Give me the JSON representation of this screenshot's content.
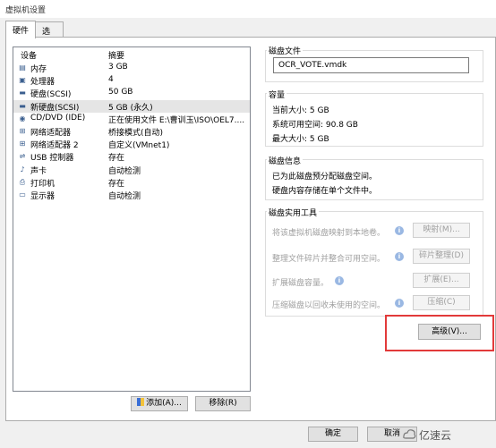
{
  "window": {
    "title": "虚拟机设置"
  },
  "tabs": [
    "硬件",
    "选项"
  ],
  "devices": {
    "col_device": "设备",
    "col_summary": "摘要",
    "rows": [
      {
        "name": "内存",
        "summary": "3 GB",
        "icon": "memory-icon"
      },
      {
        "name": "处理器",
        "summary": "4",
        "icon": "cpu-icon"
      },
      {
        "name": "硬盘(SCSI)",
        "summary": "50 GB",
        "icon": "disk-icon"
      },
      {
        "name": "新硬盘(SCSI)",
        "summary": "5 GB (永久)",
        "icon": "disk-icon",
        "selected": true
      },
      {
        "name": "CD/DVD (IDE)",
        "summary": "正在使用文件 E:\\曹训玉\\ISO\\OEL7....",
        "icon": "cd-icon"
      },
      {
        "name": "网络适配器",
        "summary": "桥接模式(自动)",
        "icon": "network-icon"
      },
      {
        "name": "网络适配器 2",
        "summary": "自定义(VMnet1)",
        "icon": "network-icon"
      },
      {
        "name": "USB 控制器",
        "summary": "存在",
        "icon": "usb-icon"
      },
      {
        "name": "声卡",
        "summary": "自动检测",
        "icon": "sound-icon"
      },
      {
        "name": "打印机",
        "summary": "存在",
        "icon": "printer-icon"
      },
      {
        "name": "显示器",
        "summary": "自动检测",
        "icon": "display-icon"
      }
    ],
    "add_label": "添加(A)...",
    "remove_label": "移除(R)"
  },
  "disk_file": {
    "label": "磁盘文件",
    "value": "OCR_VOTE.vmdk"
  },
  "capacity": {
    "label": "容量",
    "current_size": "当前大小: 5 GB",
    "free_space": "系统可用空间: 90.8 GB",
    "max_size": "最大大小: 5 GB"
  },
  "disk_info": {
    "label": "磁盘信息",
    "line1": "已为此磁盘预分配磁盘空间。",
    "line2": "硬盘内容存储在单个文件中。"
  },
  "disk_tools": {
    "label": "磁盘实用工具",
    "map_desc": "将该虚拟机磁盘映射到本地卷。",
    "map_btn": "映射(M)...",
    "defrag_desc": "整理文件碎片并整合可用空间。",
    "defrag_btn": "碎片整理(D)",
    "expand_desc": "扩展磁盘容量。",
    "expand_btn": "扩展(E)...",
    "compact_desc": "压缩磁盘以回收未使用的空间。",
    "compact_btn": "压缩(C)"
  },
  "advanced_btn": "高级(V)...",
  "footer": {
    "ok": "确定",
    "cancel": "取消"
  },
  "watermark": "亿速云",
  "colors": {
    "highlight_box": "#e23a3a",
    "selected_row": "#e5e5e5",
    "info_icon": "#3a7bd5"
  }
}
